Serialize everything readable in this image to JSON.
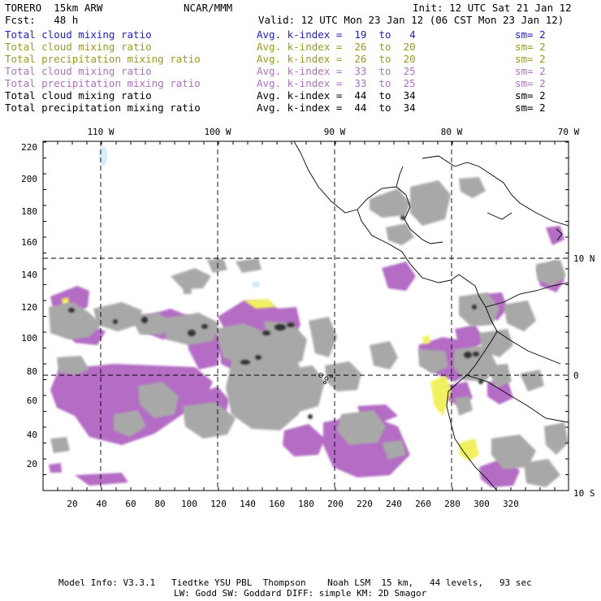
{
  "header": {
    "model": "TORERO  15km ARW",
    "center": "NCAR/MMM",
    "init": "Init: 12 UTC Sat 21 Jan 12",
    "fcst": "Fcst:   48 h",
    "valid": "Valid: 12 UTC Mon 23 Jan 12 (06 CST Mon 23 Jan 12)"
  },
  "legend": [
    {
      "field": "Total cloud mixing ratio",
      "kindex": "Avg. k-index =  19  to   4",
      "sm": "sm= 2",
      "color": "#2020c0"
    },
    {
      "field": "Total cloud mixing ratio",
      "kindex": "Avg. k-index =  26  to  20",
      "sm": "sm= 2",
      "color": "#9a9a20"
    },
    {
      "field": "Total precipitation mixing ratio",
      "kindex": "Avg. k-index =  26  to  20",
      "sm": "sm= 2",
      "color": "#9a9a20"
    },
    {
      "field": "Total cloud mixing ratio",
      "kindex": "Avg. k-index =  33  to  25",
      "sm": "sm= 2",
      "color": "#b070c0"
    },
    {
      "field": "Total precipitation mixing ratio",
      "kindex": "Avg. k-index =  33  to  25",
      "sm": "sm= 2",
      "color": "#b070c0"
    },
    {
      "field": "Total cloud mixing ratio",
      "kindex": "Avg. k-index =  44  to  34",
      "sm": "sm= 2",
      "color": "#000000"
    },
    {
      "field": "Total precipitation mixing ratio",
      "kindex": "Avg. k-index =  44  to  34",
      "sm": "sm= 2",
      "color": "#000000"
    }
  ],
  "axes": {
    "x_ticks": [
      "20",
      "40",
      "60",
      "80",
      "100",
      "120",
      "140",
      "160",
      "180",
      "200",
      "220",
      "240",
      "260",
      "280",
      "300",
      "320"
    ],
    "y_ticks": [
      "20",
      "40",
      "60",
      "80",
      "100",
      "120",
      "140",
      "160",
      "180",
      "200",
      "220"
    ],
    "lon_labels": [
      "110 W",
      "100 W",
      "90 W",
      "80 W",
      "70 W"
    ],
    "lat_labels": [
      "10 N",
      "0",
      "10 S"
    ]
  },
  "footer": {
    "line1": "Model Info: V3.3.1   Tiedtke YSU PBL  Thompson    Noah LSM  15 km,   44 levels,   93 sec",
    "line2": "LW: Godd SW: Goddard DIFF: simple KM: 2D Smagor"
  },
  "colors": {
    "gray": "#a8a8a8",
    "dark": "#303030",
    "purple": "#b46cc4",
    "yellow": "#f0f060",
    "lightblue": "#d6ecf8"
  }
}
